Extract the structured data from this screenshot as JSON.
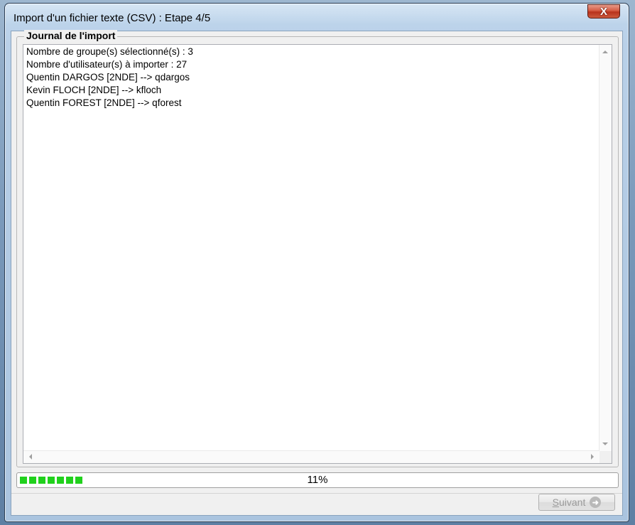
{
  "window": {
    "title": "Import d'un fichier texte (CSV) : Etape 4/5",
    "close_symbol": "X"
  },
  "journal": {
    "legend": "Journal de l'import",
    "lines": [
      "Nombre de groupe(s) sélectionné(s) : 3",
      "Nombre d'utilisateur(s) à importer : 27",
      "Quentin DARGOS [2NDE] --> qdargos",
      "Kevin FLOCH [2NDE] --> kfloch",
      "Quentin FOREST [2NDE] --> qforest"
    ]
  },
  "progress": {
    "percent_label": "11%",
    "value": 0.11,
    "color": "#21d11d"
  },
  "footer": {
    "next_button": {
      "accesskey_letter": "S",
      "label_rest": "uivant",
      "icon": "arrow-right-circle-icon",
      "enabled": false
    }
  },
  "colors": {
    "titlebar_close": "#c84a32",
    "client_bg": "#f0f0f0"
  }
}
